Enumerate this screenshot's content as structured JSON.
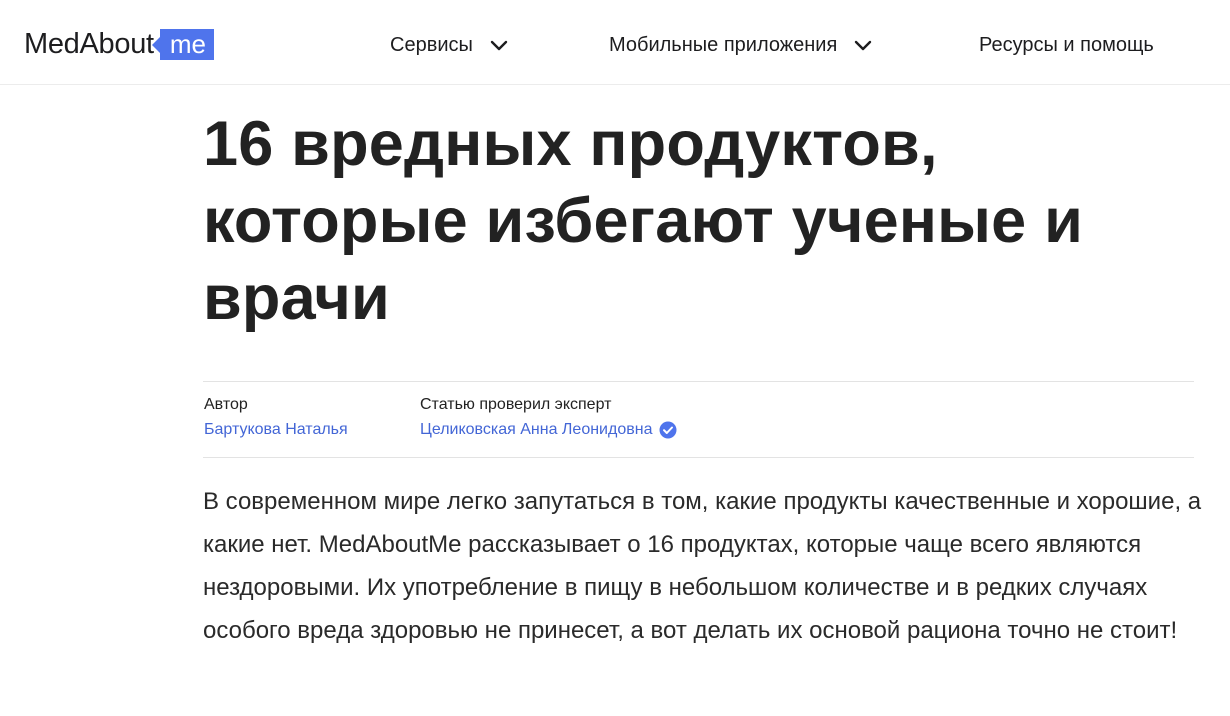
{
  "header": {
    "logo": {
      "text": "MedAbout",
      "badge": "me"
    },
    "nav": [
      {
        "label": "Сервисы",
        "has_dropdown": true
      },
      {
        "label": "Мобильные приложения",
        "has_dropdown": true
      },
      {
        "label": "Ресурсы и помощь",
        "has_dropdown": false
      }
    ]
  },
  "article": {
    "title": "16 вредных продуктов, которые избегают ученые и врачи",
    "author": {
      "label": "Автор",
      "name": "Бартукова Наталья"
    },
    "expert": {
      "label": "Статью проверил эксперт",
      "name": "Целиковская Анна Леонидовна",
      "verified_icon": "verified-check-icon"
    },
    "lead": "В современном мире легко запутаться в том, какие продукты качественные и хорошие, а какие нет. MedAboutMe рассказывает о 16 продуктах, которые чаще всего являются нездоровыми. Их употребление в пищу в небольшом количестве и в редких случаях особого вреда здоровью не принесет, а вот делать их основой рациона точно не стоит!"
  },
  "colors": {
    "brand": "#4f74ec",
    "link": "#4366d6",
    "text": "#222222"
  }
}
